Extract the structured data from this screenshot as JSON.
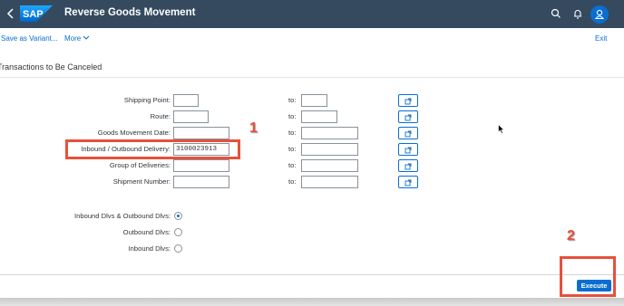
{
  "shell": {
    "logo_text": "SAP",
    "title": "Reverse Goods Movement",
    "back_icon": "chevron-left-icon",
    "search_icon": "search-icon",
    "notification_icon": "bell-icon",
    "avatar_icon": "user-icon"
  },
  "subheader": {
    "save_variant": "Save as Variant...",
    "more": "More",
    "exit": "Exit"
  },
  "section": {
    "title": "Transactions to Be Canceled"
  },
  "form": {
    "fields": [
      {
        "label": "Shipping Point:",
        "value": "",
        "to_label": "to:",
        "to_value": ""
      },
      {
        "label": "Route:",
        "value": "",
        "to_label": "to:",
        "to_value": ""
      },
      {
        "label": "Goods Movement Date:",
        "value": "",
        "to_label": "to:",
        "to_value": ""
      },
      {
        "label": "Inbound / Outbound Delivery:",
        "value": "3100023913",
        "to_label": "to:",
        "to_value": ""
      },
      {
        "label": "Group of Deliveries:",
        "value": "",
        "to_label": "to:",
        "to_value": ""
      },
      {
        "label": "Shipment Number:",
        "value": "",
        "to_label": "to:",
        "to_value": ""
      }
    ],
    "radios": [
      {
        "label": "Inbound Dlvs & Outbound Dlvs:",
        "selected": true
      },
      {
        "label": "Outbound Dlvs:",
        "selected": false
      },
      {
        "label": "Inbound Dlvs:",
        "selected": false
      }
    ]
  },
  "annotations": {
    "step1": "1",
    "step2": "2"
  },
  "footer": {
    "execute": "Execute"
  },
  "colors": {
    "shell_bg": "#354a5f",
    "accent": "#0a6ed1",
    "highlight": "#e8503a"
  }
}
